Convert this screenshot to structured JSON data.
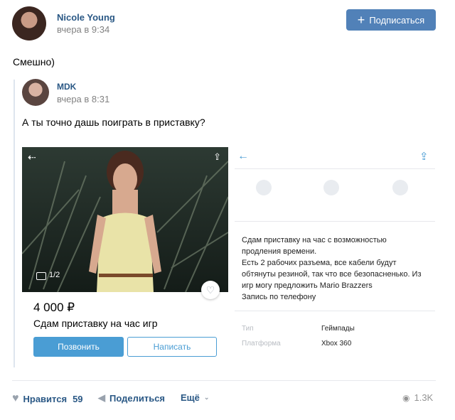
{
  "post": {
    "author": "Nicole Young",
    "time": "вчера в 9:34",
    "subscribe_label": "Подписаться",
    "text": "Смешно)"
  },
  "repost": {
    "author": "MDK",
    "time": "вчера в 8:31",
    "text": "А ты точно дашь поиграть в приставку?"
  },
  "listing": {
    "photo_counter": "1/2",
    "price": "4 000 ₽",
    "title": "Сдам приставку на час игр",
    "call_label": "Позвонить",
    "write_label": "Написать",
    "description": [
      "Сдам приставку на час с возможностью",
      "продления времени.",
      "Есть 2 рабочих разъема, все кабели будут",
      "обтянуты резиной, так что все безопасненько. Из",
      "игр могу предложить Mario Brazzers",
      "Запись по телефону"
    ],
    "props": [
      {
        "label": "Тип",
        "value": "Геймпады"
      },
      {
        "label": "Платформа",
        "value": "Xbox 360"
      }
    ]
  },
  "footer": {
    "like_label": "Нравится",
    "like_count": "59",
    "share_label": "Поделиться",
    "more_label": "Ещё",
    "views": "1.3K"
  },
  "colors": {
    "link": "#2a5885",
    "button": "#5181b8",
    "accent": "#4a9dd4"
  }
}
